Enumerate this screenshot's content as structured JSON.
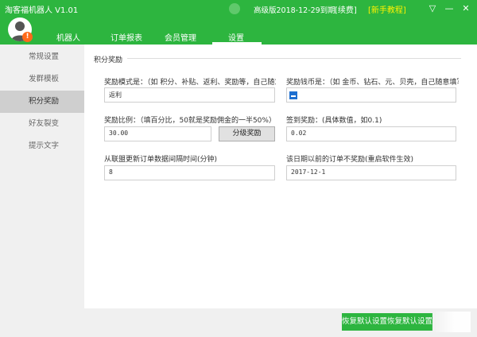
{
  "app": {
    "title": "淘客福机器人 V1.01",
    "status": "高级版2018-12-29到期",
    "renew": "[续费]",
    "tutorial": "[新手教程]",
    "controls": {
      "dropdown": "▽",
      "minimize": "—",
      "close": "✕"
    }
  },
  "nav": {
    "tabs": [
      {
        "label": "机器人"
      },
      {
        "label": "订单报表"
      },
      {
        "label": "会员管理"
      },
      {
        "label": "设置"
      }
    ],
    "active_tab": "设置",
    "badge": "!"
  },
  "sidebar": {
    "items": [
      {
        "label": "常规设置"
      },
      {
        "label": "发群模板"
      },
      {
        "label": "积分奖励"
      },
      {
        "label": "好友裂变"
      },
      {
        "label": "提示文字"
      }
    ],
    "active": "积分奖励"
  },
  "section": {
    "title": "积分奖励"
  },
  "form": {
    "reward_mode_label": "奖励模式是：（如 积分、补贴、返利、奖励等，自己随意",
    "reward_mode_value": "返利",
    "reward_currency_label": "奖励钱币是：（如 金币、钻石、元、贝壳，自己随意填写",
    "reward_currency_value": "",
    "reward_ratio_label": "奖励比例：（填百分比，50就是奖励佣金的一半50%）",
    "reward_ratio_value": "30.00",
    "grade_button": "分级奖励",
    "signin_label": "签到奖励：(具体数值，如0.1)",
    "signin_value": "0.02",
    "sync_interval_label": "从联盟更新订单数据间隔时间(分钟)",
    "sync_interval_value": "8",
    "no_reward_date_label": "该日期以前的订单不奖励(重启软件生效)",
    "no_reward_date_value": "2017-12-1"
  },
  "footer": {
    "restore_button": "恢复默认设置恢复默认设置"
  },
  "colors": {
    "brand": "#2db53f",
    "tutorial": "#fff200",
    "badge": "#ff6a1a"
  }
}
